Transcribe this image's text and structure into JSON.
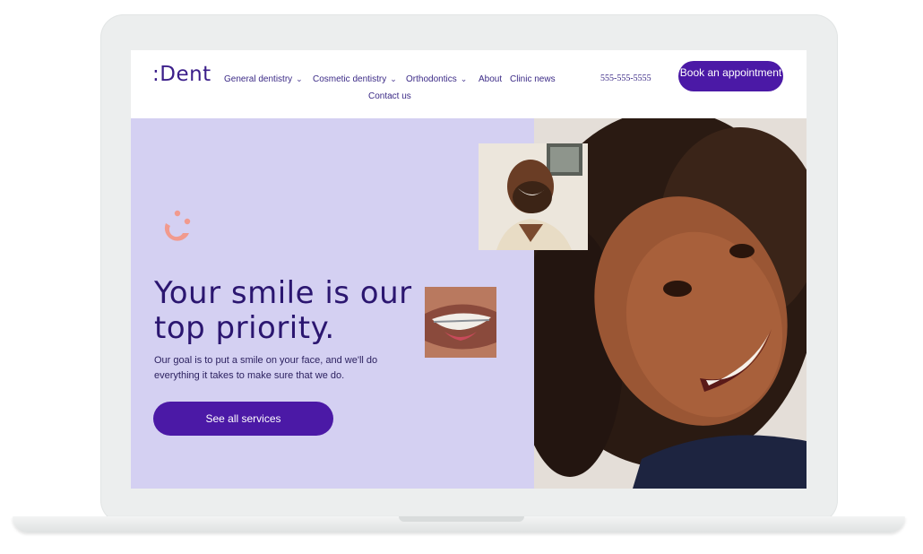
{
  "brand": {
    "logo": ":Dent",
    "accent": "#4b19a6",
    "hero_bg": "#d4d0f2",
    "text_color": "#2b1670"
  },
  "nav": {
    "items": [
      {
        "label": "General dentistry",
        "has_dropdown": true
      },
      {
        "label": "Cosmetic dentistry",
        "has_dropdown": true
      },
      {
        "label": "Orthodontics",
        "has_dropdown": true
      },
      {
        "label": "About",
        "has_dropdown": false
      },
      {
        "label": "Clinic news",
        "has_dropdown": false
      },
      {
        "label": "Contact us",
        "has_dropdown": false
      }
    ],
    "chevron": "⌄"
  },
  "header": {
    "phone": "555-555-5555",
    "book_label": "Book an appointment"
  },
  "hero": {
    "icon": "smile-icon",
    "headline": "Your smile is our top priority.",
    "subtext": "Our goal is to put a smile on your face, and we'll do everything it takes to make sure that we do.",
    "cta_label": "See all services"
  }
}
